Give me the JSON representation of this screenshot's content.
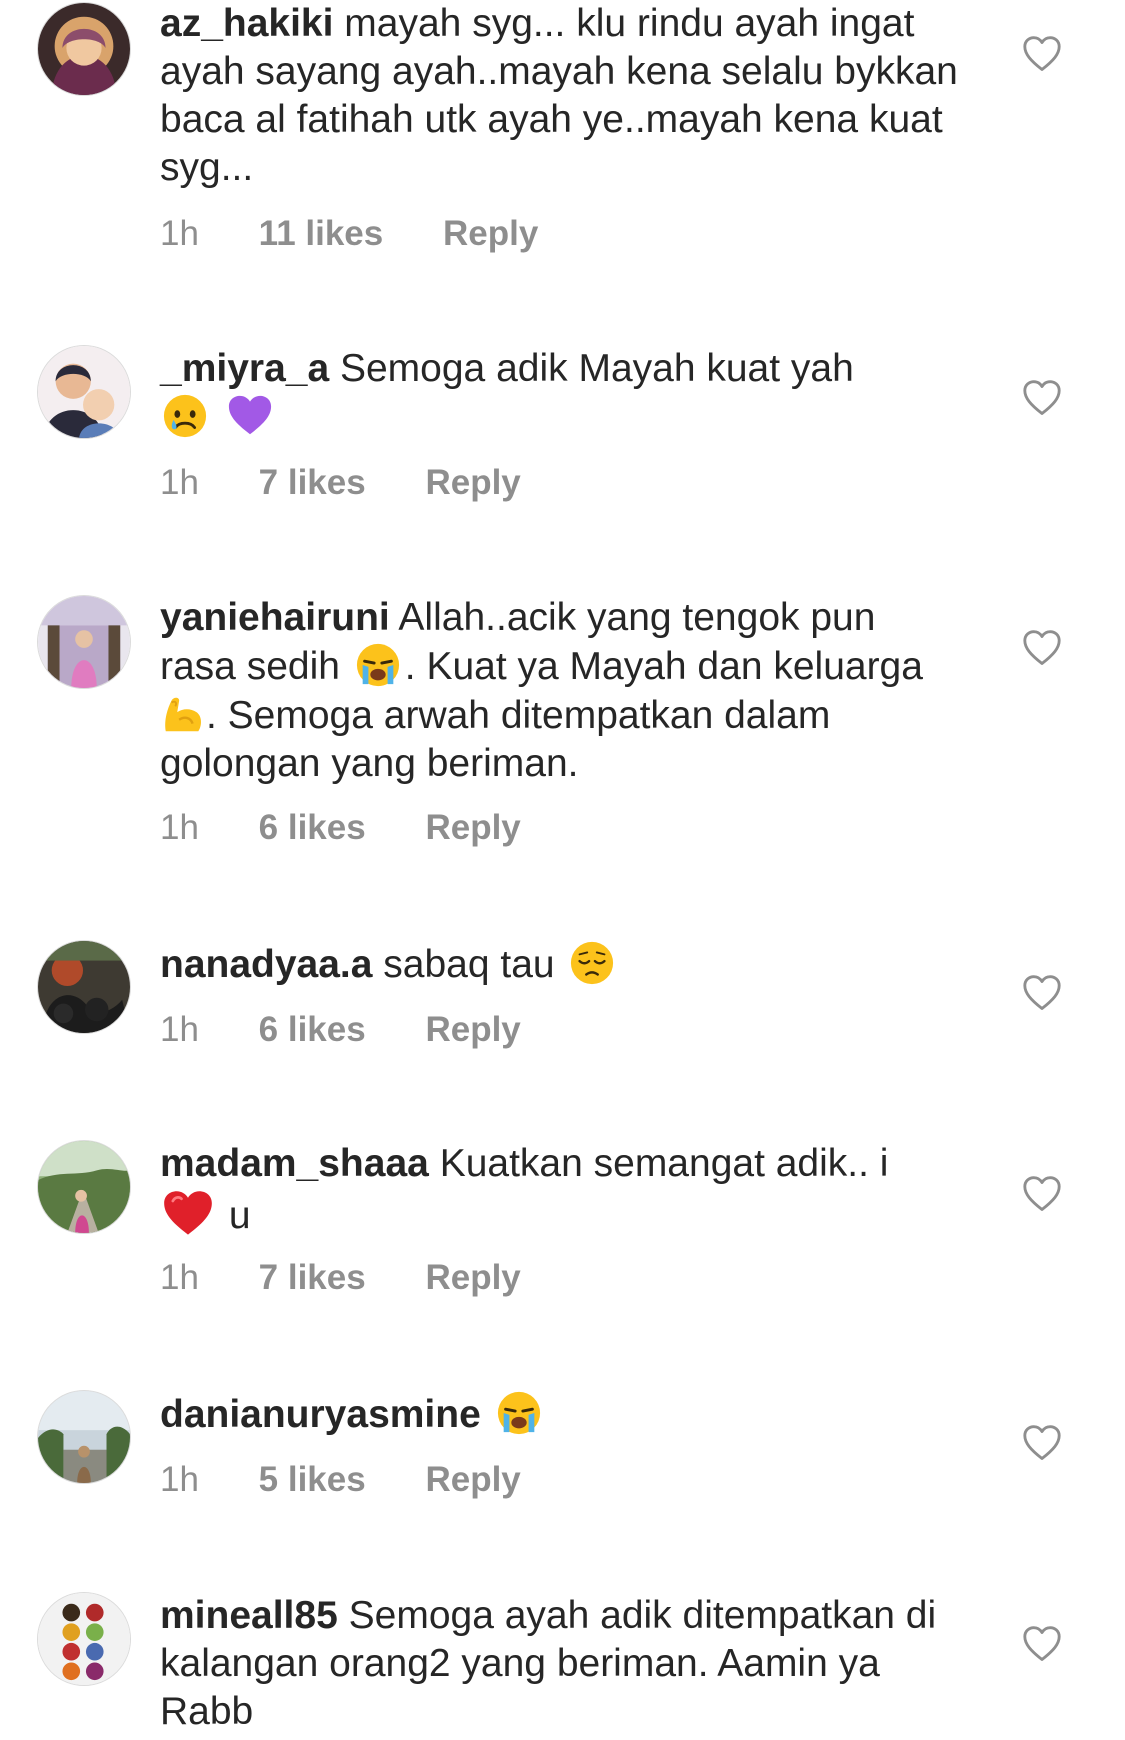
{
  "comments": [
    {
      "username": "az_hakiki",
      "parts": [
        {
          "t": "mayah syg... klu rindu ayah ingat ayah sayang ayah..mayah kena selalu bykkan baca al fatihah utk ayah ye..mayah kena kuat syg..."
        }
      ],
      "time": "1h",
      "likes": "11 likes",
      "reply": "Reply"
    },
    {
      "username": "_miyra_a",
      "parts": [
        {
          "t": "Semoga adik Mayah kuat yah "
        }
      ],
      "time": "1h",
      "likes": "7 likes",
      "reply": "Reply"
    },
    {
      "username": "yaniehairuni",
      "parts": [
        {
          "t": "Allah..acik yang tengok pun rasa sedih "
        },
        {
          "t": ". Kuat ya Mayah dan keluarga"
        },
        {
          "t": ". Semoga arwah ditempatkan dalam golongan yang beriman."
        }
      ],
      "time": "1h",
      "likes": "6 likes",
      "reply": "Reply"
    },
    {
      "username": "nanadyaa.a",
      "parts": [
        {
          "t": "sabaq tau "
        }
      ],
      "time": "1h",
      "likes": "6 likes",
      "reply": "Reply"
    },
    {
      "username": "madam_shaaa",
      "parts": [
        {
          "t": "Kuatkan semangat adik.. i "
        },
        {
          "t": " u"
        }
      ],
      "time": "1h",
      "likes": "7 likes",
      "reply": "Reply"
    },
    {
      "username": "danianuryasmine",
      "parts": [
        {
          "t": " "
        }
      ],
      "time": "1h",
      "likes": "5 likes",
      "reply": "Reply"
    },
    {
      "username": "mineall85",
      "parts": [
        {
          "t": "Semoga ayah adik ditempatkan di kalangan orang2 yang beriman. Aamin ya Rabb"
        }
      ]
    }
  ],
  "icons": {
    "heart": "heart-outline-icon",
    "emoji_crying": "crying-face-emoji",
    "emoji_purple_heart": "purple-heart-emoji",
    "emoji_sobbing": "loudly-crying-face-emoji",
    "emoji_flexed": "flexed-biceps-emoji",
    "emoji_pensive": "pensive-face-emoji",
    "emoji_red_heart": "red-heart-emoji"
  },
  "colors": {
    "text": "#262626",
    "meta": "#8e8e8e",
    "heart_stroke": "#8e8e8e"
  }
}
